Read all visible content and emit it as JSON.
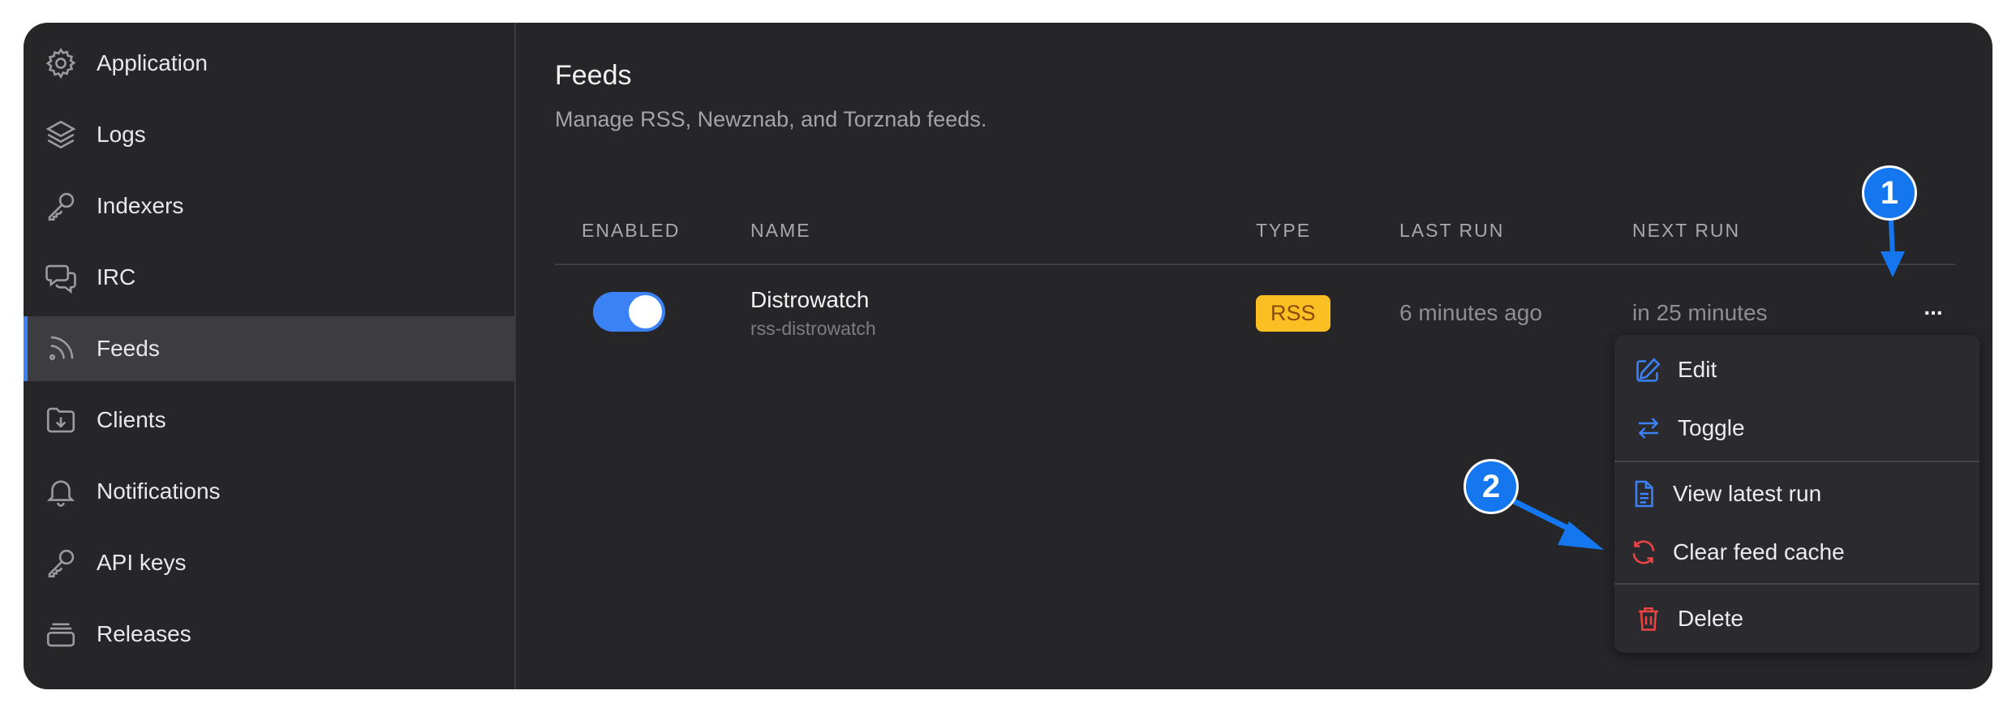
{
  "sidebar": {
    "items": [
      {
        "label": "Application",
        "icon": "gear-icon"
      },
      {
        "label": "Logs",
        "icon": "layers-icon"
      },
      {
        "label": "Indexers",
        "icon": "key-icon"
      },
      {
        "label": "IRC",
        "icon": "chat-bubbles-icon"
      },
      {
        "label": "Feeds",
        "icon": "rss-icon",
        "active": true
      },
      {
        "label": "Clients",
        "icon": "folder-download-icon"
      },
      {
        "label": "Notifications",
        "icon": "bell-icon"
      },
      {
        "label": "API keys",
        "icon": "key-icon"
      },
      {
        "label": "Releases",
        "icon": "archive-stack-icon"
      }
    ]
  },
  "main": {
    "title": "Feeds",
    "subtitle": "Manage RSS, Newznab, and Torznab feeds.",
    "table": {
      "headers": [
        "Enabled",
        "Name",
        "Type",
        "Last run",
        "Next run"
      ],
      "rows": [
        {
          "enabled": true,
          "name": "Distrowatch",
          "identifier": "rss-distrowatch",
          "type": "RSS",
          "last_run": "6 minutes ago",
          "next_run": "in 25 minutes",
          "more": "..."
        }
      ]
    },
    "menu": {
      "edit": "Edit",
      "toggle": "Toggle",
      "view_latest_run": "View latest run",
      "clear_feed_cache": "Clear feed cache",
      "delete": "Delete"
    }
  },
  "annotations": {
    "step1": "1",
    "step2": "2"
  },
  "colors": {
    "background": "#262629",
    "accent": "#3b82f6",
    "badge": "#fbbf24",
    "danger": "#ef4444",
    "annotation": "#1477f0"
  }
}
